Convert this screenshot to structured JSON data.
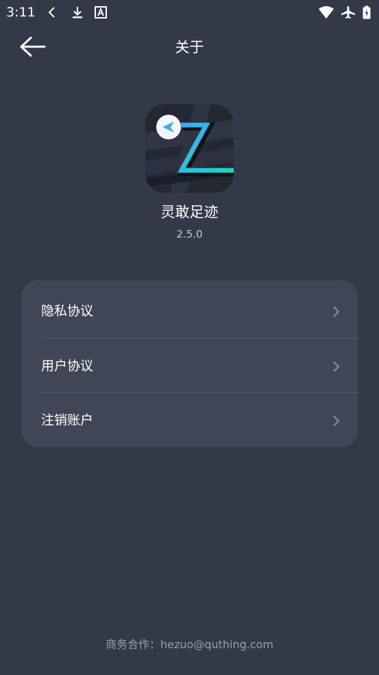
{
  "status_bar": {
    "time": "3:11",
    "icons": [
      "chevron-left-icon",
      "download-icon",
      "font-a-icon",
      "wifi-icon",
      "airplane-icon",
      "battery-charging-icon"
    ]
  },
  "header": {
    "title": "关于",
    "back_icon": "arrow-left-icon"
  },
  "app": {
    "name": "灵敢足迹",
    "version": "2.5.0"
  },
  "menu": {
    "items": [
      {
        "label": "隐私协议"
      },
      {
        "label": "用户协议"
      },
      {
        "label": "注销账户"
      }
    ]
  },
  "footer": {
    "text": "商务合作：hezuo@quthing.com"
  },
  "colors": {
    "background": "#343948",
    "card": "#414656",
    "accent_blue": "#3fa9f5",
    "accent_teal": "#21d4c4"
  }
}
